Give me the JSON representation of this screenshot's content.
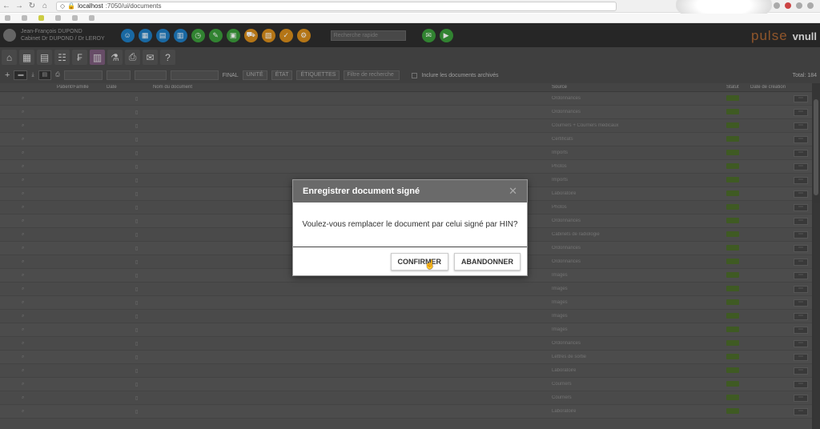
{
  "browser": {
    "url_host": "localhost",
    "url_path": ":7050/ui/documents"
  },
  "bookmarks": [],
  "user": {
    "name": "Jean-François DUPOND",
    "cabinet": "Cabinet Dr DUPOND / Dr LEROY"
  },
  "header": {
    "search_placeholder": "Recherche rapide"
  },
  "logo": {
    "pulse": "pulse",
    "vnull": "vnull"
  },
  "toolbar": {
    "filter_label": "FINAL",
    "unite": "UNITÉ",
    "etat": "ÉTAT",
    "etiquettes": "ÉTIQUETTES",
    "filter_placeholder": "Filtre de recherche",
    "include_archived": "Inclure les documents archivés",
    "total_label": "Total: 184"
  },
  "grid": {
    "columns": [
      "",
      "Patient/Famille",
      "Date",
      "",
      "Nom du document",
      "Source",
      "Statut",
      "Date de création",
      ""
    ],
    "rows": [
      {
        "source": "Ordonnances"
      },
      {
        "source": "Ordonnances"
      },
      {
        "source": "Courriers + Courriers médicaux"
      },
      {
        "source": "Certificats"
      },
      {
        "source": "Imports"
      },
      {
        "source": "Photos"
      },
      {
        "source": "Imports"
      },
      {
        "source": "Laboratoire"
      },
      {
        "source": "Photos"
      },
      {
        "source": "Ordonnances"
      },
      {
        "source": "Cabinets de radiologie"
      },
      {
        "source": "Ordonnances"
      },
      {
        "source": "Ordonnances"
      },
      {
        "source": "Images"
      },
      {
        "source": "Images"
      },
      {
        "source": "Images"
      },
      {
        "source": "Images"
      },
      {
        "source": "Images"
      },
      {
        "source": "Ordonnances"
      },
      {
        "source": "Lettres de sortie"
      },
      {
        "source": "Laboratoire"
      },
      {
        "source": "Courriers"
      },
      {
        "source": "Courriers"
      },
      {
        "source": "Laboratoire"
      }
    ]
  },
  "modal": {
    "title": "Enregistrer document signé",
    "message": "Voulez-vous remplacer le document par celui signé par HIN?",
    "confirm_label": "CONFIRMER",
    "cancel_label": "ABANDONNER"
  }
}
